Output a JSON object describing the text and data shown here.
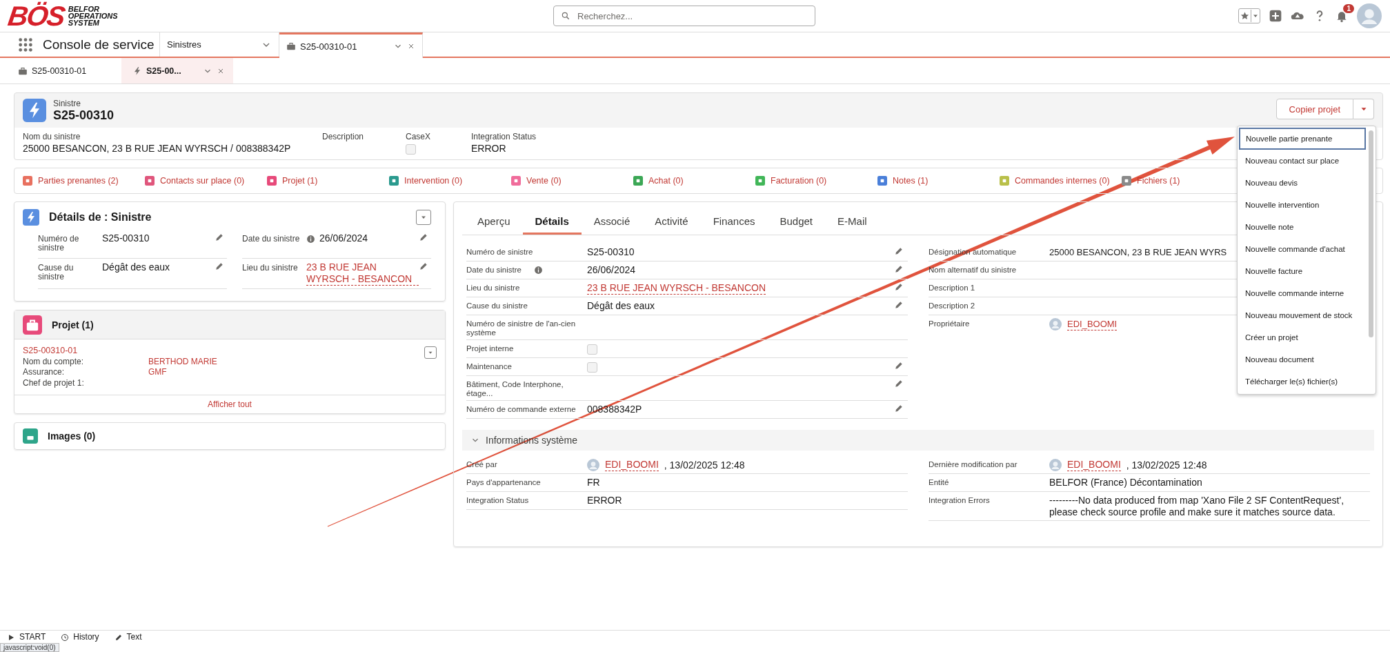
{
  "header": {
    "logo": {
      "mark": "BÖS",
      "tagline": [
        "BELFOR",
        "OPERATIONS",
        "SYSTEM"
      ]
    },
    "search": {
      "placeholder": "Recherchez..."
    },
    "notification_count": "1"
  },
  "app": {
    "name": "Console de service",
    "object_tab": "Sinistres",
    "tabs": [
      {
        "label": "S25-00310-01",
        "selected": true
      }
    ]
  },
  "subtabs": [
    {
      "label": "S25-00310-01",
      "selected": false
    },
    {
      "label": "S25-00...",
      "selected": true
    }
  ],
  "record": {
    "object": "Sinistre",
    "title": "S25-00310",
    "action": "Copier projet",
    "fields": [
      {
        "label": "Nom du sinistre",
        "kind": "text",
        "value": "25000 BESANCON, 23 B RUE JEAN WYRSCH / 008388342P"
      },
      {
        "label": "Description",
        "kind": "text"
      },
      {
        "label": "CaseX",
        "kind": "checkbox",
        "checked": false
      },
      {
        "label": "Integration Status",
        "kind": "text",
        "value": "ERROR"
      }
    ]
  },
  "related_links": [
    {
      "label": "Parties prenantes (2)",
      "color": "#e8705f"
    },
    {
      "label": "Contacts sur place (0)",
      "color": "#e0567c"
    },
    {
      "label": "Projet (1)",
      "color": "#e74a7a"
    },
    {
      "label": "Intervention (0)",
      "color": "#2a9a8e"
    },
    {
      "label": "Vente (0)",
      "color": "#f06c9b"
    },
    {
      "label": "Achat (0)",
      "color": "#3ba755"
    },
    {
      "label": "Facturation (0)",
      "color": "#41b658"
    },
    {
      "label": "Notes (1)",
      "color": "#4a7fd9"
    },
    {
      "label": "Commandes internes (0)",
      "color": "#b9c04a"
    },
    {
      "label": "Fichiers (1)",
      "color": "#8a8a8a"
    }
  ],
  "details_card": {
    "title": "Détails de : Sinistre",
    "fields": [
      {
        "label": "Numéro de sinistre",
        "kind": "text",
        "value": "S25-00310",
        "editable": true
      },
      {
        "label": "Date du sinistre",
        "kind": "text",
        "value": "26/06/2024",
        "info": true,
        "editable": true
      },
      {
        "label": "Cause du sinistre",
        "kind": "text",
        "value": "Dégât des eaux",
        "editable": true
      },
      {
        "label": "Lieu du sinistre",
        "kind": "link",
        "value": "23 B RUE JEAN WYRSCH - BESANCON",
        "editable": true
      }
    ]
  },
  "project_card": {
    "title": "Projet (1)",
    "record": {
      "name": "S25-00310-01",
      "fields": [
        {
          "label": "Nom du compte:",
          "value": "BERTHOD MARIE"
        },
        {
          "label": "Assurance:",
          "value": "GMF"
        },
        {
          "label": "Chef de projet 1:"
        }
      ]
    },
    "view_all": "Afficher tout"
  },
  "images_card": {
    "title": "Images (0)"
  },
  "detail_panel": {
    "tabs": [
      {
        "label": "Aperçu",
        "selected": false
      },
      {
        "label": "Détails",
        "selected": true
      },
      {
        "label": "Associé",
        "selected": false
      },
      {
        "label": "Activité",
        "selected": false
      },
      {
        "label": "Finances",
        "selected": false
      },
      {
        "label": "Budget",
        "selected": false
      },
      {
        "label": "E-Mail",
        "selected": false
      }
    ],
    "left_fields": [
      {
        "label": "Numéro de sinistre",
        "kind": "text",
        "value": "S25-00310",
        "editable": true
      },
      {
        "label": "Date du sinistre",
        "kind": "text",
        "value": "26/06/2024",
        "info": true,
        "editable": true
      },
      {
        "label": "Lieu du sinistre",
        "kind": "link",
        "value": "23 B RUE JEAN WYRSCH - BESANCON",
        "editable": true
      },
      {
        "label": "Cause du sinistre",
        "kind": "text",
        "value": "Dégât des eaux",
        "editable": true
      },
      {
        "label": "Numéro de sinistre de l'an-cien système",
        "kind": "text",
        "editable": false
      },
      {
        "label": "Projet interne",
        "kind": "checkbox",
        "checked": false,
        "editable": false
      },
      {
        "label": "Maintenance",
        "kind": "checkbox",
        "checked": false,
        "editable": true
      },
      {
        "label": "Bâtiment, Code Interphone, étage...",
        "kind": "text",
        "editable": true
      },
      {
        "label": "Numéro de commande externe",
        "kind": "text",
        "value": "008388342P",
        "editable": true
      }
    ],
    "right_fields": [
      {
        "label": "Désignation automatique",
        "kind": "text",
        "value": "25000 BESANCON, 23 B RUE JEAN WYRS",
        "editable": false
      },
      {
        "label": "Nom alternatif du sinistre",
        "kind": "text",
        "editable": false
      },
      {
        "label": "Description 1",
        "kind": "text",
        "editable": false
      },
      {
        "label": "Description 2",
        "kind": "text",
        "editable": false
      },
      {
        "label": "Propriétaire",
        "kind": "user",
        "value": "EDI_BOOMI",
        "editable": false
      }
    ],
    "section": {
      "title": "Informations système",
      "expanded": true,
      "left_fields": [
        {
          "label": "Créé par",
          "kind": "user",
          "value": "EDI_BOOMI",
          "suffix": ", 13/02/2025 12:48"
        },
        {
          "label": "Pays d'appartenance",
          "kind": "text",
          "value": "FR"
        },
        {
          "label": "Integration Status",
          "kind": "text",
          "value": "ERROR"
        }
      ],
      "right_fields": [
        {
          "label": "Dernière modification par",
          "kind": "user",
          "value": "EDI_BOOMI",
          "suffix": ", 13/02/2025 12:48"
        },
        {
          "label": "Entité",
          "kind": "text",
          "value": "BELFOR (France) Décontamination"
        },
        {
          "label": "Integration Errors",
          "kind": "text",
          "value": "---------No data produced from map 'Xano File 2 SF ContentRequest', please check source profile and make sure it matches source data."
        }
      ]
    }
  },
  "menu": {
    "items": [
      {
        "label": "Nouvelle partie prenante",
        "selected": true
      },
      {
        "label": "Nouveau contact sur place",
        "selected": false
      },
      {
        "label": "Nouveau devis",
        "selected": false
      },
      {
        "label": "Nouvelle intervention",
        "selected": false
      },
      {
        "label": "Nouvelle note",
        "selected": false
      },
      {
        "label": "Nouvelle commande d'achat",
        "selected": false
      },
      {
        "label": "Nouvelle facture",
        "selected": false
      },
      {
        "label": "Nouvelle commande interne",
        "selected": false
      },
      {
        "label": "Nouveau mouvement de stock",
        "selected": false
      },
      {
        "label": "Créer un projet",
        "selected": false
      },
      {
        "label": "Nouveau document",
        "selected": false
      },
      {
        "label": "Télécharger le(s) fichier(s)",
        "selected": false
      }
    ]
  },
  "footer": {
    "items": [
      {
        "label": "START"
      },
      {
        "label": "History"
      },
      {
        "label": "Text"
      }
    ],
    "status_url": "javascript:void(0)"
  }
}
